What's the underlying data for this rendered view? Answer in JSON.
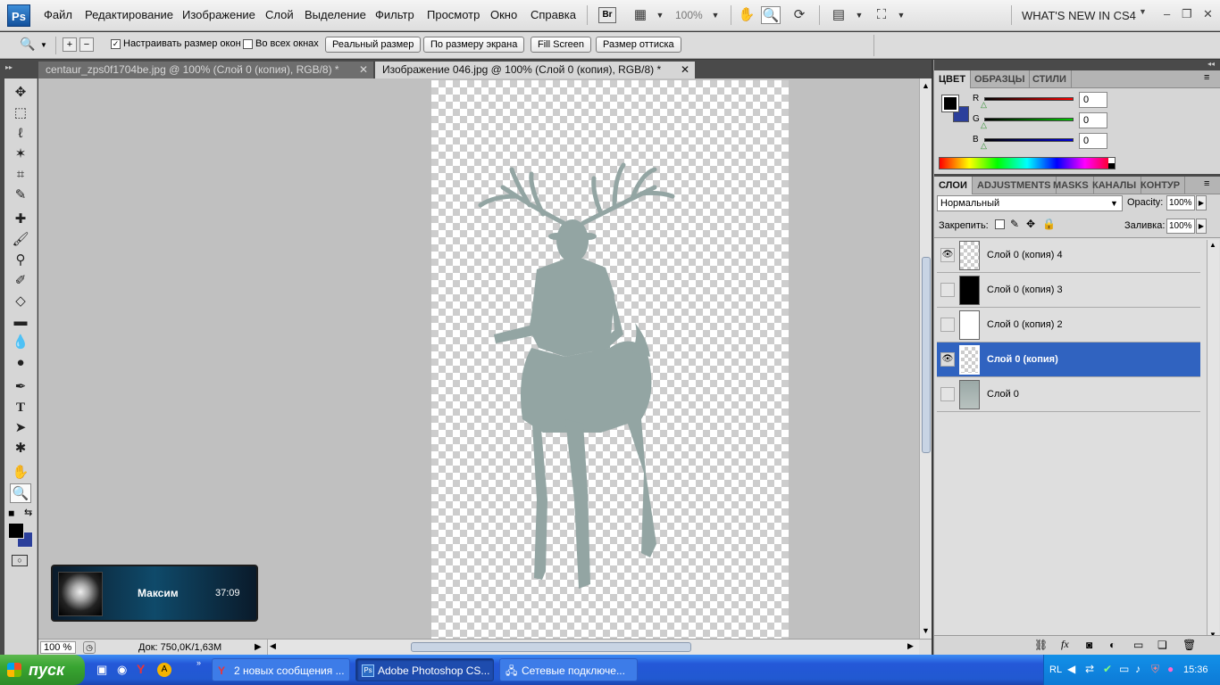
{
  "app": {
    "logo": "Ps",
    "workspace": "WHAT'S NEW IN CS4"
  },
  "menu": [
    "Файл",
    "Редактирование",
    "Изображение",
    "Слой",
    "Выделение",
    "Фильтр",
    "Просмотр",
    "Окно",
    "Справка"
  ],
  "menubar": {
    "bridge": "Br",
    "zoom": "100%"
  },
  "options": {
    "resize_windows_label": "Настраивать размер окон",
    "resize_windows_checked": true,
    "all_windows_label": "Во всех окнах",
    "all_windows_checked": false,
    "actual_pixels": "Реальный размер",
    "fit_screen": "По размеру экрана",
    "fill_screen": "Fill Screen",
    "print_size": "Размер оттиска"
  },
  "tabs": [
    {
      "label": "centaur_zps0f1704be.jpg @ 100% (Слой 0 (копия), RGB/8) *",
      "active": false
    },
    {
      "label": "Изображение 046.jpg @ 100% (Слой 0 (копия), RGB/8) *",
      "active": true
    }
  ],
  "status": {
    "zoom": "100 %",
    "doc": "Док: 750,0K/1,63M"
  },
  "notification": {
    "name": "Максим",
    "time": "37:09"
  },
  "color_panel": {
    "tabs": [
      "ЦВЕТ",
      "ОБРАЗЦЫ",
      "СТИЛИ"
    ],
    "r_label": "R",
    "g_label": "G",
    "b_label": "B",
    "r": "0",
    "g": "0",
    "b": "0",
    "foreground": "#000000",
    "background": "#2b3f9b"
  },
  "layers_panel": {
    "tabs": [
      "СЛОИ",
      "ADJUSTMENTS",
      "MASKS",
      "КАНАЛЫ",
      "КОНТУР"
    ],
    "blend_mode": "Нормальный",
    "opacity_label": "Opacity:",
    "opacity": "100%",
    "lock_label": "Закрепить:",
    "fill_label": "Заливка:",
    "fill": "100%",
    "layers": [
      {
        "name": "Слой 0 (копия) 4",
        "visible": true,
        "selected": false,
        "thumb": "checker"
      },
      {
        "name": "Слой 0 (копия) 3",
        "visible": false,
        "selected": false,
        "thumb": "black"
      },
      {
        "name": "Слой 0 (копия) 2",
        "visible": false,
        "selected": false,
        "thumb": "white"
      },
      {
        "name": "Слой 0 (копия)",
        "visible": true,
        "selected": true,
        "thumb": "checker"
      },
      {
        "name": "Слой 0",
        "visible": false,
        "selected": false,
        "thumb": "photo"
      }
    ]
  },
  "taskbar": {
    "start": "пуск",
    "items": [
      {
        "label": "2 новых сообщения ...",
        "active": false
      },
      {
        "label": "Adobe Photoshop CS...",
        "active": true
      },
      {
        "label": "Сетевые подключе...",
        "active": false
      }
    ],
    "lang": "RL",
    "clock": "15:36"
  }
}
